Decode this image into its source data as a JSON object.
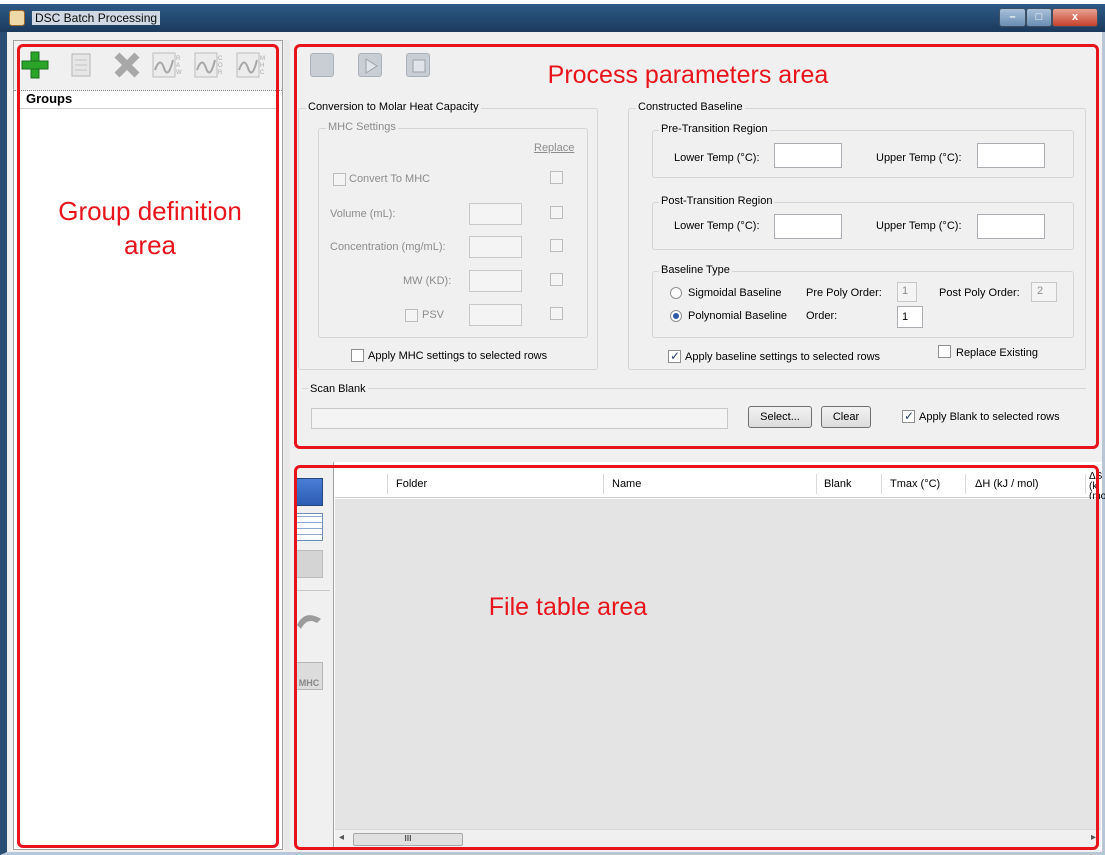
{
  "window": {
    "title": "DSC Batch Processing",
    "minimize_label": "–",
    "maximize_label": "□",
    "close_label": "x"
  },
  "left": {
    "groups_title": "Groups",
    "toolbar_icons": [
      "add-group-icon",
      "edit-group-icon",
      "delete-group-icon",
      "raw-plot-icon",
      "cor-plot-icon",
      "mhc-plot-icon"
    ],
    "toolbar_icon_letters": {
      "raw": "R A W",
      "cor": "C O R",
      "mhc": "M H C"
    }
  },
  "annotations": {
    "process": "Process parameters area",
    "group": "Group definition area",
    "filetable": "File table area"
  },
  "process": {
    "toolbar_icons": [
      "open-batch-icon",
      "run-icon",
      "stop-icon"
    ],
    "mhc_group_label": "Conversion to Molar Heat Capacity",
    "mhc_settings_label": "MHC Settings",
    "replace_label": "Replace",
    "convert_label": "Convert To MHC",
    "volume_label": "Volume (mL):",
    "concentration_label": "Concentration (mg/mL):",
    "mw_label": "MW (KD):",
    "psv_label": "PSV",
    "apply_mhc_label": "Apply MHC settings to selected rows",
    "baseline_group_label": "Constructed Baseline",
    "pre_region_label": "Pre-Transition Region",
    "post_region_label": "Post-Transition Region",
    "lower_temp_label": "Lower Temp (°C):",
    "upper_temp_label": "Upper Temp (°C):",
    "baseline_type_label": "Baseline Type",
    "sigmoidal_label": "Sigmoidal Baseline",
    "polynomial_label": "Polynomial Baseline",
    "pre_poly_label": "Pre Poly Order:",
    "post_poly_label": "Post Poly Order:",
    "order_label": "Order:",
    "pre_poly_value": "1",
    "post_poly_value": "2",
    "order_value": "1",
    "apply_baseline_label": "Apply baseline settings to selected rows",
    "replace_existing_label": "Replace Existing",
    "scan_blank_label": "Scan Blank",
    "select_button": "Select...",
    "clear_button": "Clear",
    "apply_blank_label": "Apply Blank to selected rows"
  },
  "filetable": {
    "columns": [
      "Folder",
      "Name",
      "Blank",
      "Tmax (°C)",
      "ΔH (kJ / mol)",
      "ΔS (k",
      "(mo"
    ],
    "side_icons": [
      "select-all-icon",
      "grid-view-icon",
      "copy-icon",
      "fit-icon",
      "mhc-icon"
    ],
    "mhc_icon_text": "MHC",
    "scroll_thumb_grip": "III",
    "scroll_left": "◂",
    "scroll_right": "▸"
  },
  "colors": {
    "annotation_red": "#e8141b",
    "titlebar": "#2e5a86",
    "add_icon_green": "#2aa52a"
  }
}
